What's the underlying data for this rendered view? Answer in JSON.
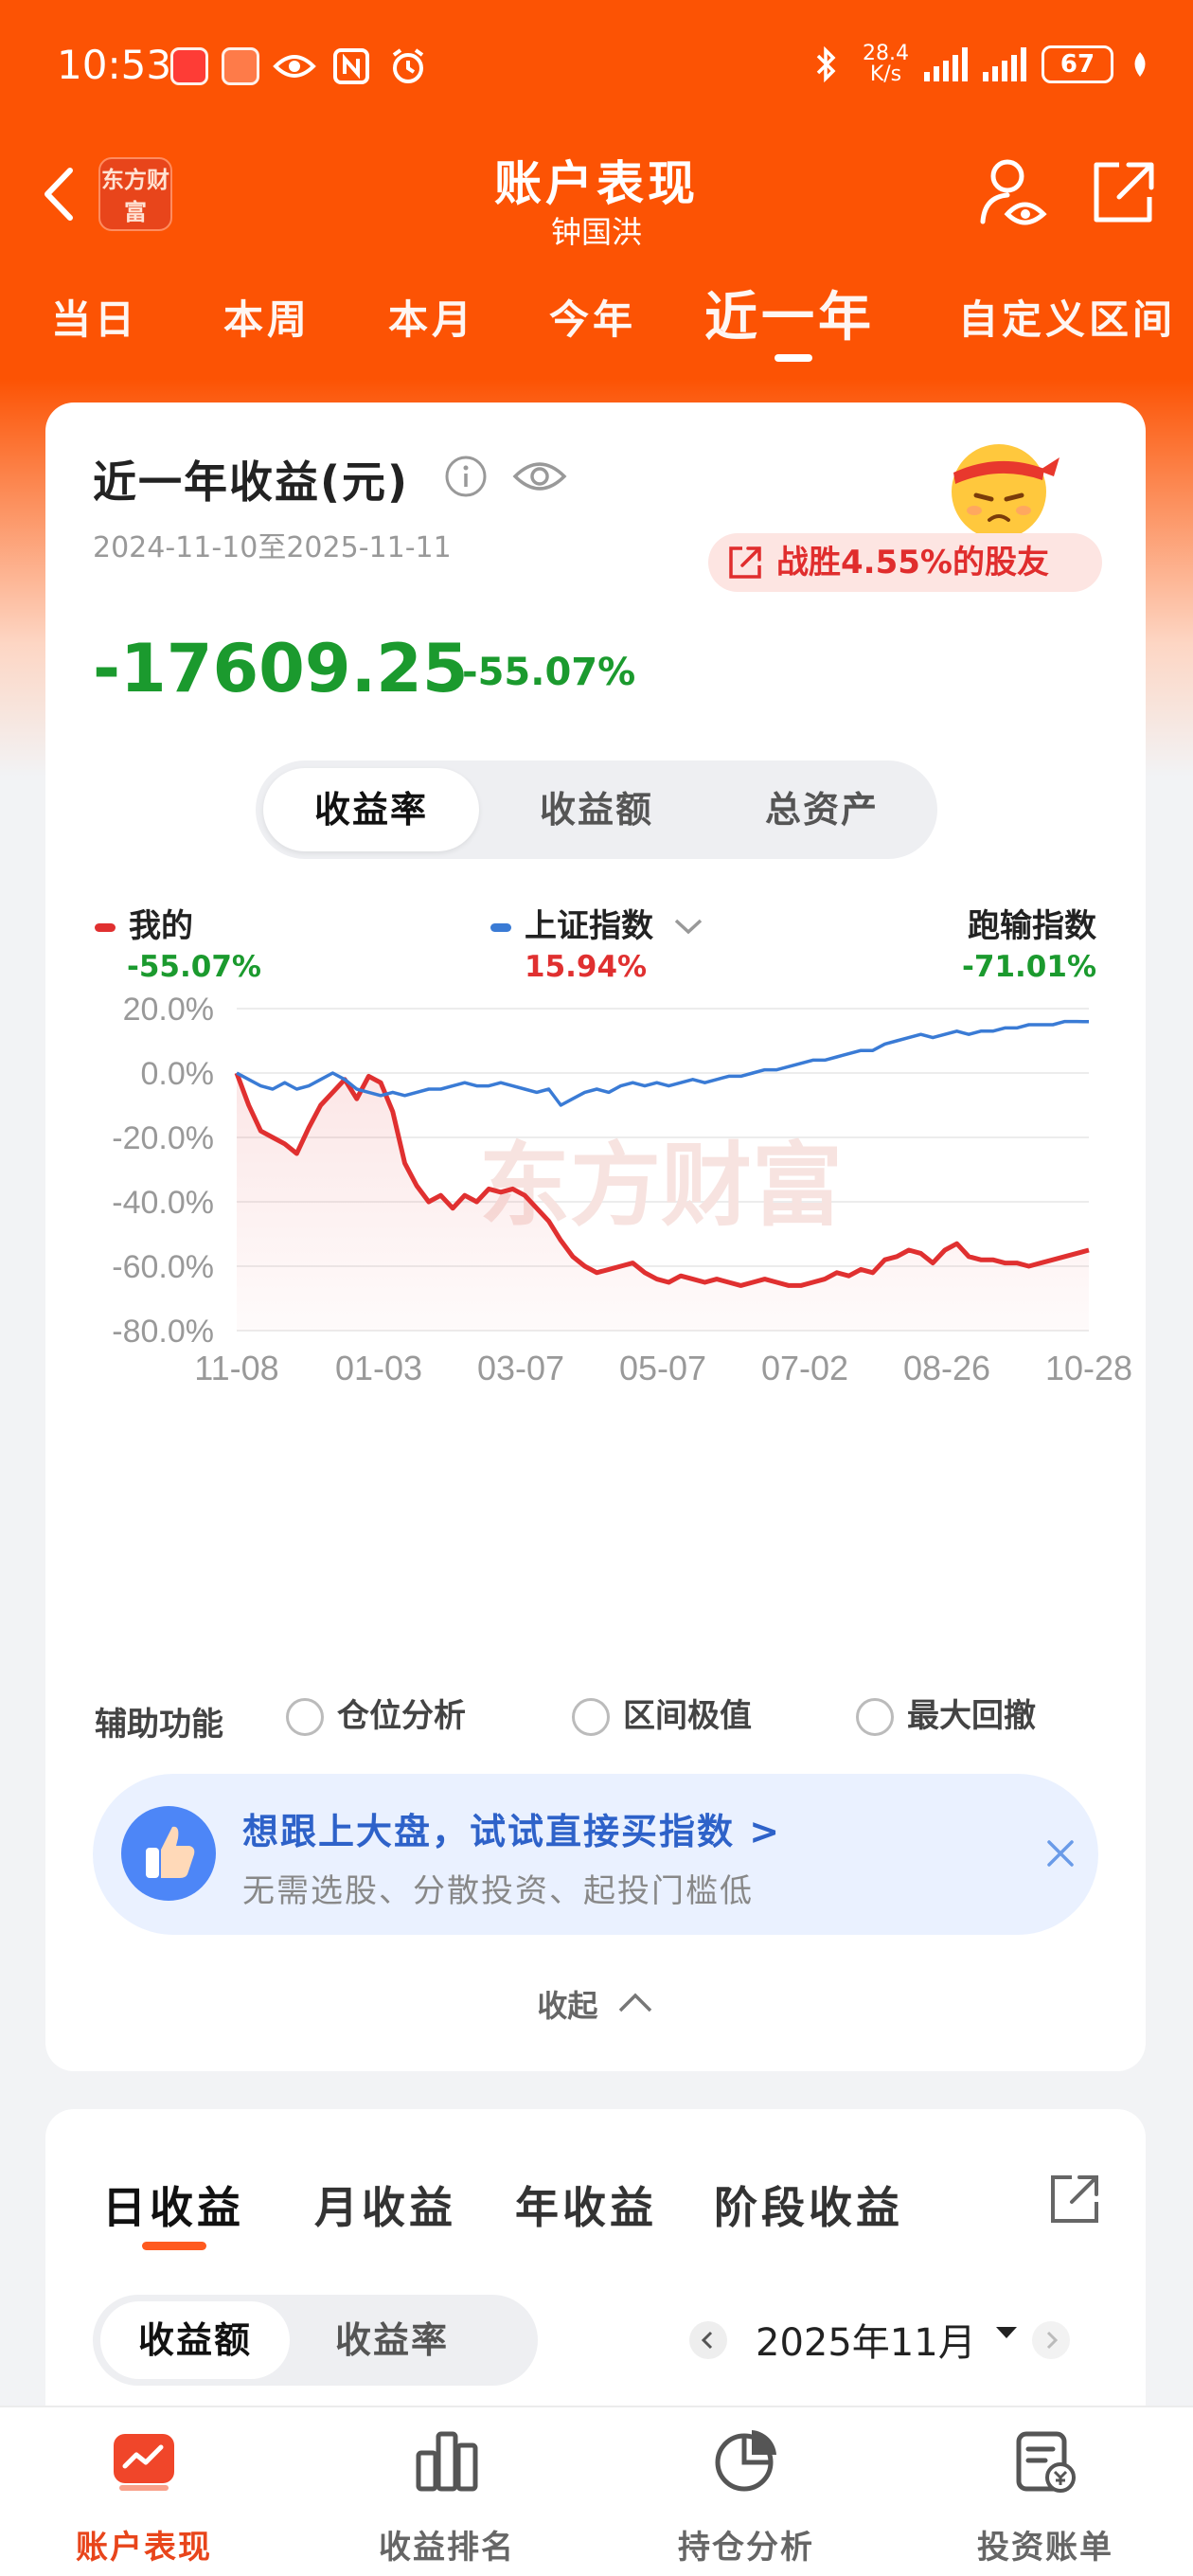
{
  "status_bar": {
    "time": "10:53",
    "net_speed_value": "28.4",
    "net_speed_unit": "K/s",
    "battery": "67"
  },
  "header": {
    "logo_text": "东方财富",
    "title": "账户表现",
    "subtitle": "钟国洪"
  },
  "period_tabs": [
    "当日",
    "本周",
    "本月",
    "今年",
    "近一年",
    "自定义区间"
  ],
  "active_period": "近一年",
  "summary": {
    "title": "近一年收益(元)",
    "date_range": "2024-11-10至2025-11-11",
    "beat_text": "战胜4.55%的股友",
    "profit_amount": "-17609.25",
    "profit_pct": "-55.07%"
  },
  "metric_tabs": [
    "收益率",
    "收益额",
    "总资产"
  ],
  "legend": {
    "mine_label": "我的",
    "mine_value": "-55.07%",
    "index_label": "上证指数",
    "index_value": "15.94%",
    "excess_label": "跑输指数",
    "excess_value": "-71.01%"
  },
  "chart_data": {
    "type": "line",
    "watermark": "东方财富",
    "x_ticks": [
      "11-08",
      "01-03",
      "03-07",
      "05-07",
      "07-02",
      "08-26",
      "10-28"
    ],
    "y_ticks": [
      "20.0%",
      "0.0%",
      "-20.0%",
      "-40.0%",
      "-60.0%",
      "-80.0%"
    ],
    "ylim": [
      -80,
      20
    ],
    "series": [
      {
        "name": "我的",
        "color": "#e03030",
        "values": [
          0,
          -10,
          -18,
          -20,
          -22,
          -25,
          -17,
          -10,
          -6,
          -2,
          -8,
          -1,
          -3,
          -12,
          -28,
          -35,
          -40,
          -38,
          -42,
          -38,
          -40,
          -36,
          -37,
          -36,
          -38,
          -42,
          -46,
          -52,
          -57,
          -60,
          -62,
          -61,
          -60,
          -59,
          -62,
          -64,
          -65,
          -63,
          -64,
          -65,
          -64,
          -65,
          -66,
          -65,
          -64,
          -65,
          -66,
          -66,
          -65,
          -64,
          -62,
          -63,
          -61,
          -62,
          -58,
          -57,
          -55,
          -56,
          -59,
          -55,
          -53,
          -57,
          -58,
          -58,
          -59,
          -59,
          -60,
          -59,
          -58,
          -57,
          -56,
          -55
        ]
      },
      {
        "name": "上证指数",
        "color": "#3a7bd5",
        "values": [
          0,
          -2,
          -4,
          -5,
          -3,
          -5,
          -4,
          -2,
          0,
          -2,
          -5,
          -6,
          -7,
          -6,
          -7,
          -6,
          -5,
          -5,
          -4,
          -3,
          -4,
          -4,
          -3,
          -4,
          -5,
          -6,
          -5,
          -10,
          -8,
          -6,
          -5,
          -6,
          -4,
          -3,
          -4,
          -3,
          -4,
          -3,
          -2,
          -3,
          -2,
          -1,
          -1,
          0,
          1,
          1,
          2,
          3,
          4,
          4,
          5,
          6,
          7,
          7,
          9,
          10,
          11,
          12,
          11,
          12,
          13,
          12,
          13,
          13,
          14,
          14,
          15,
          15,
          15,
          16,
          16,
          15.94
        ]
      }
    ]
  },
  "aux": {
    "label": "辅助功能",
    "options": [
      "仓位分析",
      "区间极值",
      "最大回撤"
    ]
  },
  "promo": {
    "title": "想跟上大盘，试试直接买指数 >",
    "subtitle": "无需选股、分散投资、起投门槛低"
  },
  "collapse_label": "收起",
  "earnings_tabs": [
    "日收益",
    "月收益",
    "年收益",
    "阶段收益"
  ],
  "earnings_toggle": [
    "收益额",
    "收益率"
  ],
  "month": "2025年11月",
  "bottom_nav": [
    "账户表现",
    "收益排名",
    "持仓分析",
    "投资账单"
  ],
  "colors": {
    "brand": "#fc5304",
    "gain": "#e03030",
    "loss": "#1b9a2e",
    "index_line": "#3a7bd5"
  }
}
